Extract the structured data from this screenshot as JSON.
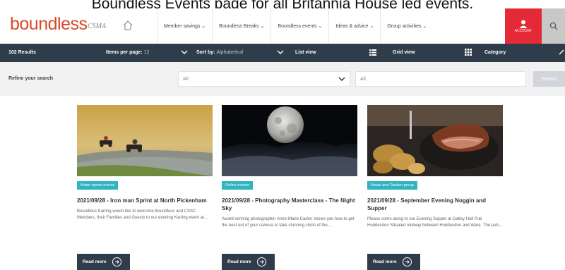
{
  "caption": "Boundless Events page for all Britannia House led events.",
  "brand": {
    "logo": "boundless",
    "sub": "CSMA",
    "accent": "#d84a2c"
  },
  "nav": {
    "items": [
      "Member savings",
      "Boundless Breaks",
      "Boundless events",
      "Ideas & advice",
      "Group activities"
    ],
    "account_label": "ACCOUNT"
  },
  "results_bar": {
    "count": "102 Results",
    "per_page_label": "Items per page:",
    "per_page_value": "12",
    "sort_label": "Sort by:",
    "sort_value": "Alphabetical",
    "list_view": "List view",
    "grid_view": "Grid view",
    "category": "Category"
  },
  "refine": {
    "label": "Refine your search",
    "select_value": "All",
    "input_value": "All",
    "search_button": "Search"
  },
  "cards": [
    {
      "tag": "Motor sports events",
      "title": "2021/09/28 - Iron man Sprint at North Pickenham",
      "desc": "Boundless Karting would like to welcome Boundless and CSSC Members, their Families and Guests to our evening Karting event at...",
      "read_more": "Read more"
    },
    {
      "tag": "Online events",
      "title": "2021/09/28 - Photography Masterclass - The Night Sky",
      "desc": "Award-winning photographer Anne-Marie Caster shows you how to get the best out of your camera to take stunning shots of the...",
      "read_more": "Read more"
    },
    {
      "tag": "Meals and Garden group",
      "title": "2021/09/28 - September Evening Noggin and Supper",
      "desc": "Please come along to our Evening Supper at Gatley Hall Pub Hoddesdon Situated midway between Hoddesdon and Ware. The pub...",
      "read_more": "Read more"
    }
  ],
  "colors": {
    "navy": "#2f3d4a",
    "teal": "#2fb4c0",
    "account_red": "#e32a36"
  }
}
